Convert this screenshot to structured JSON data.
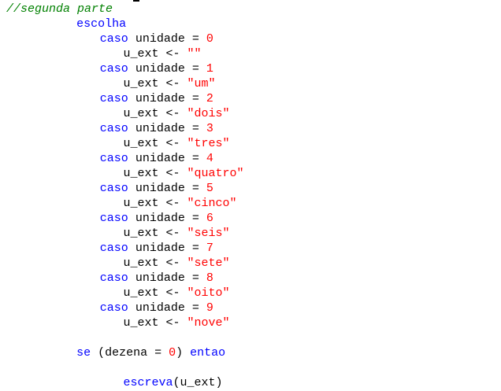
{
  "editor": {
    "lines": [
      {
        "indent": 0,
        "tokens": [
          {
            "t": "comment",
            "v": "//segunda parte"
          }
        ]
      },
      {
        "indent": 6,
        "tokens": [
          {
            "t": "kw",
            "v": "escolha"
          }
        ]
      },
      {
        "indent": 8,
        "tokens": [
          {
            "t": "kw",
            "v": "caso"
          },
          {
            "t": "text",
            "v": " unidade = "
          },
          {
            "t": "num",
            "v": "0"
          }
        ]
      },
      {
        "indent": 10,
        "tokens": [
          {
            "t": "text",
            "v": "u_ext <- "
          },
          {
            "t": "str",
            "v": "\"\""
          }
        ]
      },
      {
        "indent": 8,
        "tokens": [
          {
            "t": "kw",
            "v": "caso"
          },
          {
            "t": "text",
            "v": " unidade = "
          },
          {
            "t": "num",
            "v": "1"
          }
        ]
      },
      {
        "indent": 10,
        "tokens": [
          {
            "t": "text",
            "v": "u_ext <- "
          },
          {
            "t": "str",
            "v": "\"um\""
          }
        ]
      },
      {
        "indent": 8,
        "tokens": [
          {
            "t": "kw",
            "v": "caso"
          },
          {
            "t": "text",
            "v": " unidade = "
          },
          {
            "t": "num",
            "v": "2"
          }
        ]
      },
      {
        "indent": 10,
        "tokens": [
          {
            "t": "text",
            "v": "u_ext <- "
          },
          {
            "t": "str",
            "v": "\"dois\""
          }
        ]
      },
      {
        "indent": 8,
        "tokens": [
          {
            "t": "kw",
            "v": "caso"
          },
          {
            "t": "text",
            "v": " unidade = "
          },
          {
            "t": "num",
            "v": "3"
          }
        ]
      },
      {
        "indent": 10,
        "tokens": [
          {
            "t": "text",
            "v": "u_ext <- "
          },
          {
            "t": "str",
            "v": "\"tres\""
          }
        ]
      },
      {
        "indent": 8,
        "tokens": [
          {
            "t": "kw",
            "v": "caso"
          },
          {
            "t": "text",
            "v": " unidade = "
          },
          {
            "t": "num",
            "v": "4"
          }
        ]
      },
      {
        "indent": 10,
        "tokens": [
          {
            "t": "text",
            "v": "u_ext <- "
          },
          {
            "t": "str",
            "v": "\"quatro\""
          }
        ]
      },
      {
        "indent": 8,
        "tokens": [
          {
            "t": "kw",
            "v": "caso"
          },
          {
            "t": "text",
            "v": " unidade = "
          },
          {
            "t": "num",
            "v": "5"
          }
        ]
      },
      {
        "indent": 10,
        "tokens": [
          {
            "t": "text",
            "v": "u_ext <- "
          },
          {
            "t": "str",
            "v": "\"cinco\""
          }
        ]
      },
      {
        "indent": 8,
        "tokens": [
          {
            "t": "kw",
            "v": "caso"
          },
          {
            "t": "text",
            "v": " unidade = "
          },
          {
            "t": "num",
            "v": "6"
          }
        ]
      },
      {
        "indent": 10,
        "tokens": [
          {
            "t": "text",
            "v": "u_ext <- "
          },
          {
            "t": "str",
            "v": "\"seis\""
          }
        ]
      },
      {
        "indent": 8,
        "tokens": [
          {
            "t": "kw",
            "v": "caso"
          },
          {
            "t": "text",
            "v": " unidade = "
          },
          {
            "t": "num",
            "v": "7"
          }
        ]
      },
      {
        "indent": 10,
        "tokens": [
          {
            "t": "text",
            "v": "u_ext <- "
          },
          {
            "t": "str",
            "v": "\"sete\""
          }
        ]
      },
      {
        "indent": 8,
        "tokens": [
          {
            "t": "kw",
            "v": "caso"
          },
          {
            "t": "text",
            "v": " unidade = "
          },
          {
            "t": "num",
            "v": "8"
          }
        ]
      },
      {
        "indent": 10,
        "tokens": [
          {
            "t": "text",
            "v": "u_ext <- "
          },
          {
            "t": "str",
            "v": "\"oito\""
          }
        ]
      },
      {
        "indent": 8,
        "tokens": [
          {
            "t": "kw",
            "v": "caso"
          },
          {
            "t": "text",
            "v": " unidade = "
          },
          {
            "t": "num",
            "v": "9"
          }
        ]
      },
      {
        "indent": 10,
        "tokens": [
          {
            "t": "text",
            "v": "u_ext <- "
          },
          {
            "t": "str",
            "v": "\"nove\""
          }
        ]
      },
      {
        "indent": 0,
        "tokens": []
      },
      {
        "indent": 6,
        "tokens": [
          {
            "t": "kw",
            "v": "se"
          },
          {
            "t": "text",
            "v": " (dezena = "
          },
          {
            "t": "num",
            "v": "0"
          },
          {
            "t": "text",
            "v": ") "
          },
          {
            "t": "kw",
            "v": "entao"
          }
        ]
      },
      {
        "indent": 0,
        "tokens": []
      },
      {
        "indent": 10,
        "tokens": [
          {
            "t": "kw",
            "v": "escreva"
          },
          {
            "t": "text",
            "v": "(u_ext)"
          }
        ]
      }
    ]
  },
  "colors": {
    "keyword": "#0000ff",
    "comment": "#008000",
    "literal": "#ff0000",
    "text": "#000000",
    "background": "#ffffff"
  }
}
